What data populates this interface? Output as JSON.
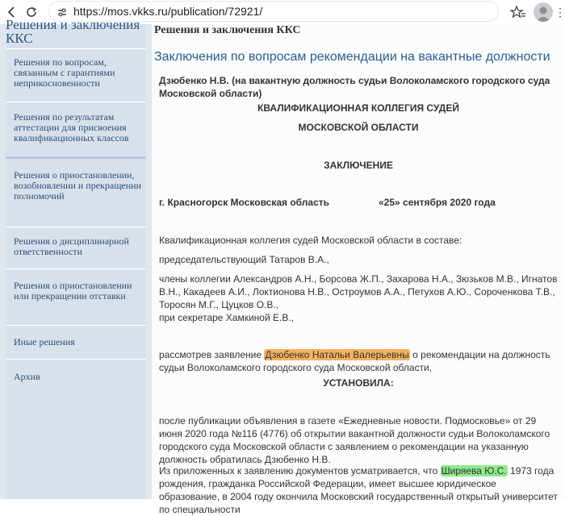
{
  "browser": {
    "url": "https://mos.vkks.ru/publication/72921/"
  },
  "sidebar": {
    "title": "Решения и заключения ККС",
    "items": [
      {
        "label": "Решения по вопросам, связанным с гарантиями неприкосновенности"
      },
      {
        "label": "Решения по результатам аттестации для присвоения квалификационных классов"
      },
      {
        "label": "Решения о приостановлении, возобновлении и прекращении полномочий"
      },
      {
        "label": "Решения о дисциплинарной ответственности"
      },
      {
        "label": "Решения о приостановлении или прекращении отставки"
      },
      {
        "label": "Иные решения"
      },
      {
        "label": "Архив"
      }
    ]
  },
  "main": {
    "section_title": "Решения и заключения ККС",
    "heading": "Заключения по вопросам рекомендации на вакантные должности",
    "doc": {
      "subject": "Дзюбенко Н.В. (на вакантную должность судьи Волоколамского городского суда Московской области)",
      "org_line1": "КВАЛИФИКАЦИОННАЯ КОЛЛЕГИЯ СУДЕЙ",
      "org_line2": "МОСКОВСКОЙ ОБЛАСТИ",
      "doc_type": "ЗАКЛЮЧЕНИЕ",
      "place": "г. Красногорск Московская область",
      "date": "«25» сентября 2020 года",
      "p1": "Квалификационная коллегия судей Московской области в составе:",
      "p2": "председательствующий Татаров В.А.,",
      "p3": "члены коллегии Александров А.Н., Борсова Ж.П., Захарова Н.А., Зюзьков М.В., Игнатов В.Н., Какадеев А.И., Локтионова Н.В., Остроумов А.А., Петухов А.Ю., Сороченкова Т.В., Торосян М.Г., Цуцков О.В.,",
      "p4": "при секретаре Хамкиной Е.В.,",
      "p5_before": "рассмотрев заявление ",
      "p5_name": "Дзюбенко Натальи Валерьевны",
      "p5_after": " о рекомендации на должность судьи Волоколамского городского суда Московской области,",
      "established": "УСТАНОВИЛА:",
      "p6": "после публикации объявления в газете «Ежедневные новости. Подмосковье» от 29 июня 2020 года №116 (4776) об открытии вакантной должности судьи Волоколамского городского суда Московской области с заявлением о рекомендации на указанную должность обратилась Дзюбенко Н.В.",
      "p7_before": "Из приложенных к заявлению документов усматривается, что ",
      "p7_name": "Ширяева Ю.С.",
      "p7_after": " 1973 года рождения, гражданка Российской Федерации, имеет высшее юридическое образование, в 2004 году окончила Московский государственный открытый университет по специальности"
    }
  },
  "colors": {
    "highlight_orange": "#f5b25f",
    "highlight_green": "#8fe98b",
    "link_blue": "#2a5d8c"
  }
}
